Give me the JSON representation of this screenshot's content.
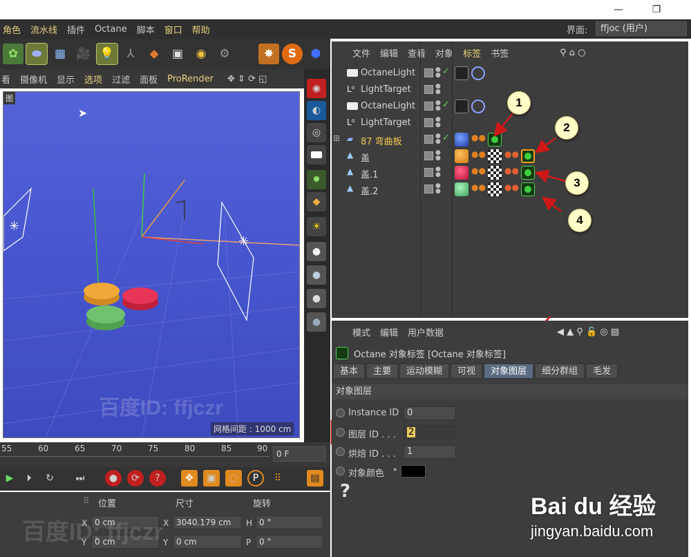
{
  "window": {
    "minimize": "—",
    "restore": "❐"
  },
  "menubar": {
    "items": [
      "角色",
      "流水线",
      "插件",
      "Octane",
      "脚本",
      "窗口",
      "帮助"
    ],
    "layout_label": "界面:",
    "layout_value": "ffjoc (用户)"
  },
  "viewport_menu": {
    "items": [
      "看",
      "摄像机",
      "显示",
      "选项",
      "过滤",
      "面板",
      "ProRender"
    ],
    "corner_label": "图"
  },
  "viewport": {
    "grid_label": "网格间距 : 1000 cm",
    "watermark": "百度ID: ffjczr"
  },
  "object_manager": {
    "menu": [
      "文件",
      "编辑",
      "查看",
      "对象",
      "标签",
      "书签"
    ],
    "rows": [
      {
        "name": "OctaneLight",
        "type": "light"
      },
      {
        "name": "LightTarget",
        "type": "target"
      },
      {
        "name": "OctaneLight",
        "type": "light"
      },
      {
        "name": "LightTarget",
        "type": "target"
      },
      {
        "name": "87 弯曲板",
        "type": "bend"
      },
      {
        "name": "盖",
        "type": "cap"
      },
      {
        "name": "盖.1",
        "type": "cap"
      },
      {
        "name": "盖.2",
        "type": "cap"
      }
    ],
    "callouts": [
      "1",
      "2",
      "3",
      "4"
    ]
  },
  "attribute_manager": {
    "menu": [
      "模式",
      "编辑",
      "用户数据"
    ],
    "title": "Octane 对象标签 [Octane 对象标签]",
    "tabs": [
      "基本",
      "主要",
      "运动模糊",
      "可视",
      "对象图层",
      "细分群组",
      "毛发"
    ],
    "active_tab": "对象图层",
    "section": "对象图层",
    "params": [
      {
        "label": "Instance ID",
        "value": "0"
      },
      {
        "label": "图层 ID . . .",
        "value": "2"
      },
      {
        "label": "烘焙 ID . . .",
        "value": "1"
      },
      {
        "label": "对象颜色",
        "value": ""
      }
    ],
    "help": "?"
  },
  "timeline": {
    "ticks": [
      "55",
      "60",
      "65",
      "70",
      "75",
      "80",
      "85",
      "90"
    ],
    "frame": "0 F"
  },
  "coords": {
    "headers": [
      "位置",
      "尺寸",
      "旋转"
    ],
    "row1": {
      "x_label": "X",
      "x": "0 cm",
      "sx_label": "X",
      "sx": "3040.179 cm",
      "h_label": "H",
      "h": "0 °"
    },
    "row2": {
      "y_label": "Y",
      "y": "0 cm",
      "sy_label": "Y",
      "sy": "0 cm",
      "p_label": "P",
      "p": "0 °"
    }
  },
  "watermarks": {
    "baidu_logo": "Bai du 经验",
    "baidu_url": "jingyan.baidu.com"
  },
  "colors": {
    "accent_red": "#d01818",
    "menu_yellow": "#e2cf7d",
    "viewport_blue": "#4857cf"
  }
}
